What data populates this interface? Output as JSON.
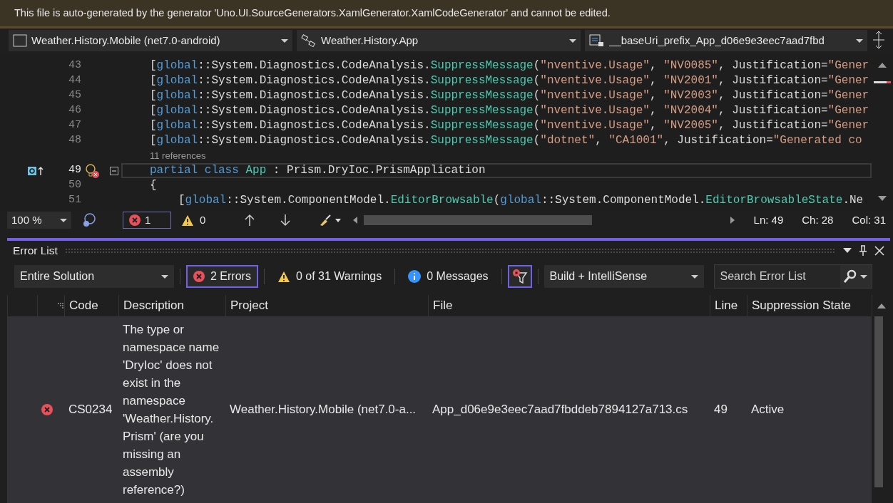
{
  "info_bar": {
    "text": "This file is auto-generated by the generator 'Uno.UI.SourceGenerators.XamlGenerator.XamlCodeGenerator' and cannot be edited."
  },
  "nav_bar": [
    {
      "kind": "project",
      "text": "Weather.History.Mobile (net7.0-android)"
    },
    {
      "kind": "type",
      "text": "Weather.History.App"
    },
    {
      "kind": "member",
      "text": "__baseUri_prefix_App_d06e9e3eec7aad7fbd"
    }
  ],
  "editor": {
    "lines": [
      {
        "number": "43",
        "segments": [
          {
            "kind": "plain",
            "text": "["
          },
          {
            "kind": "kw",
            "text": "global"
          },
          {
            "kind": "plain",
            "text": "::System.Diagnostics.CodeAnalysis."
          },
          {
            "kind": "type",
            "text": "SuppressMessage"
          },
          {
            "kind": "plain",
            "text": "("
          },
          {
            "kind": "str",
            "text": "\"nventive.Usage\""
          },
          {
            "kind": "plain",
            "text": ", "
          },
          {
            "kind": "str",
            "text": "\"NV0085\""
          },
          {
            "kind": "plain",
            "text": ", Justification="
          },
          {
            "kind": "str",
            "text": "\"Gener"
          }
        ]
      },
      {
        "number": "44",
        "segments": [
          {
            "kind": "plain",
            "text": "["
          },
          {
            "kind": "kw",
            "text": "global"
          },
          {
            "kind": "plain",
            "text": "::System.Diagnostics.CodeAnalysis."
          },
          {
            "kind": "type",
            "text": "SuppressMessage"
          },
          {
            "kind": "plain",
            "text": "("
          },
          {
            "kind": "str",
            "text": "\"nventive.Usage\""
          },
          {
            "kind": "plain",
            "text": ", "
          },
          {
            "kind": "str",
            "text": "\"NV2001\""
          },
          {
            "kind": "plain",
            "text": ", Justification="
          },
          {
            "kind": "str",
            "text": "\"Gener"
          }
        ]
      },
      {
        "number": "45",
        "segments": [
          {
            "kind": "plain",
            "text": "["
          },
          {
            "kind": "kw",
            "text": "global"
          },
          {
            "kind": "plain",
            "text": "::System.Diagnostics.CodeAnalysis."
          },
          {
            "kind": "type",
            "text": "SuppressMessage"
          },
          {
            "kind": "plain",
            "text": "("
          },
          {
            "kind": "str",
            "text": "\"nventive.Usage\""
          },
          {
            "kind": "plain",
            "text": ", "
          },
          {
            "kind": "str",
            "text": "\"NV2003\""
          },
          {
            "kind": "plain",
            "text": ", Justification="
          },
          {
            "kind": "str",
            "text": "\"Gener"
          }
        ]
      },
      {
        "number": "46",
        "segments": [
          {
            "kind": "plain",
            "text": "["
          },
          {
            "kind": "kw",
            "text": "global"
          },
          {
            "kind": "plain",
            "text": "::System.Diagnostics.CodeAnalysis."
          },
          {
            "kind": "type",
            "text": "SuppressMessage"
          },
          {
            "kind": "plain",
            "text": "("
          },
          {
            "kind": "str",
            "text": "\"nventive.Usage\""
          },
          {
            "kind": "plain",
            "text": ", "
          },
          {
            "kind": "str",
            "text": "\"NV2004\""
          },
          {
            "kind": "plain",
            "text": ", Justification="
          },
          {
            "kind": "str",
            "text": "\"Gener"
          }
        ]
      },
      {
        "number": "47",
        "segments": [
          {
            "kind": "plain",
            "text": "["
          },
          {
            "kind": "kw",
            "text": "global"
          },
          {
            "kind": "plain",
            "text": "::System.Diagnostics.CodeAnalysis."
          },
          {
            "kind": "type",
            "text": "SuppressMessage"
          },
          {
            "kind": "plain",
            "text": "("
          },
          {
            "kind": "str",
            "text": "\"nventive.Usage\""
          },
          {
            "kind": "plain",
            "text": ", "
          },
          {
            "kind": "str",
            "text": "\"NV2005\""
          },
          {
            "kind": "plain",
            "text": ", Justification="
          },
          {
            "kind": "str",
            "text": "\"Gener"
          }
        ]
      },
      {
        "number": "48",
        "segments": [
          {
            "kind": "plain",
            "text": "["
          },
          {
            "kind": "kw",
            "text": "global"
          },
          {
            "kind": "plain",
            "text": "::System.Diagnostics.CodeAnalysis."
          },
          {
            "kind": "type",
            "text": "SuppressMessage"
          },
          {
            "kind": "plain",
            "text": "("
          },
          {
            "kind": "str",
            "text": "\"dotnet\""
          },
          {
            "kind": "plain",
            "text": ", "
          },
          {
            "kind": "str",
            "text": "\"CA1001\""
          },
          {
            "kind": "plain",
            "text": ", Justification="
          },
          {
            "kind": "str",
            "text": "\"Generated co"
          }
        ]
      },
      {
        "codelens": "11 references"
      },
      {
        "number": "49",
        "current": true,
        "segments": [
          {
            "kind": "kw",
            "text": "partial class"
          },
          {
            "kind": "type",
            "text": " App"
          },
          {
            "kind": "plain",
            "text": " : Prism.DryIoc.PrismApplication"
          }
        ]
      },
      {
        "number": "50",
        "segments": [
          {
            "kind": "plain",
            "text": "{"
          }
        ]
      },
      {
        "number": "51",
        "indent": true,
        "segments": [
          {
            "kind": "plain",
            "text": "["
          },
          {
            "kind": "kw",
            "text": "global"
          },
          {
            "kind": "plain",
            "text": "::System.ComponentModel."
          },
          {
            "kind": "type",
            "text": "EditorBrowsable"
          },
          {
            "kind": "plain",
            "text": "("
          },
          {
            "kind": "kw",
            "text": "global"
          },
          {
            "kind": "plain",
            "text": "::System.ComponentModel."
          },
          {
            "kind": "type",
            "text": "EditorBrowsableState"
          },
          {
            "kind": "plain",
            "text": ".Ne"
          }
        ]
      }
    ]
  },
  "editor_status": {
    "zoom": "100 %",
    "errors": "1",
    "warnings": "0",
    "ln": "Ln: 49",
    "ch": "Ch: 28",
    "col": "Col: 31"
  },
  "error_list": {
    "title": "Error List",
    "scope": "Entire Solution",
    "filters": [
      {
        "kind": "error",
        "text": "2 Errors",
        "selected": true
      },
      {
        "kind": "warning",
        "text": "0 of 31 Warnings",
        "selected": false
      },
      {
        "kind": "info",
        "text": "0 Messages",
        "selected": false
      }
    ],
    "source": "Build + IntelliSense",
    "search": {
      "placeholder": "Search Error List"
    },
    "columns": [
      "Code",
      "Description",
      "Project",
      "File",
      "Line",
      "Suppression State"
    ],
    "rows": [
      {
        "kind": "error",
        "code": "CS0234",
        "description": "The type or namespace name 'DryIoc' does not exist in the namespace 'Weather.History.Prism' (are you missing an assembly reference?)",
        "project": "Weather.History.Mobile (net7.0-a...",
        "file": "App_d06e9e3eec7aad7fbddeb7894127a713.cs",
        "line": "49",
        "suppression": "Active"
      }
    ]
  }
}
